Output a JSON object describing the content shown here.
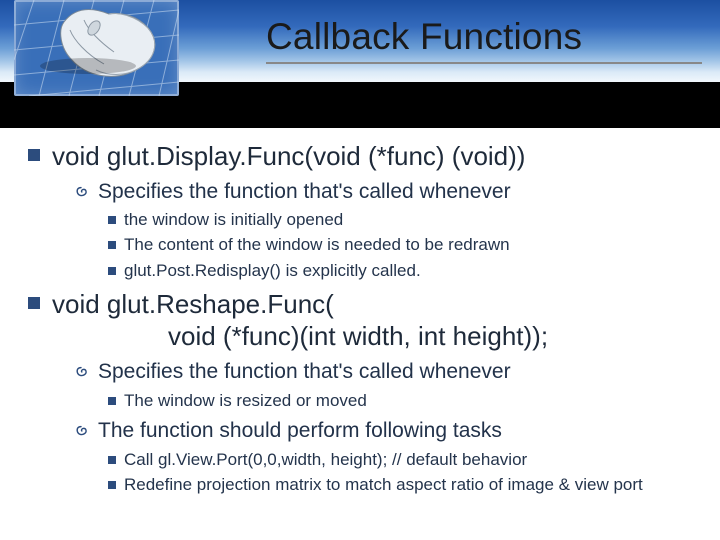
{
  "title": "Callback Functions",
  "headerImage": {
    "name": "computer-mouse-over-grid"
  },
  "sections": [
    {
      "heading": "void glut.Display.Func(void (*func) (void))",
      "subs": [
        {
          "text": "Specifies the function that's called whenever",
          "bullets": [
            "the window is initially opened",
            "The content of the window is needed to be redrawn",
            "glut.Post.Redisplay() is explicitly called."
          ]
        }
      ]
    },
    {
      "heading": "void glut.Reshape.Func(",
      "heading_line2": "void (*func)(int width, int height));",
      "subs": [
        {
          "text": "Specifies the function that's called whenever",
          "bullets": [
            "The window is resized or moved"
          ]
        },
        {
          "text": "The function should perform following tasks",
          "bullets": [
            "Call gl.View.Port(0,0,width, height); // default behavior",
            "Redefine projection matrix to match aspect ratio of image & view port"
          ]
        }
      ]
    }
  ]
}
